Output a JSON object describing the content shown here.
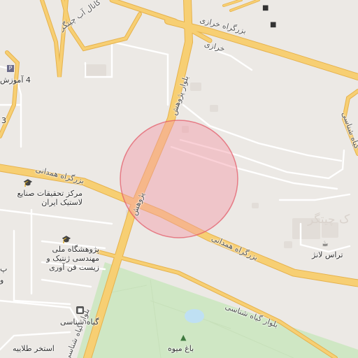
{
  "map": {
    "colors": {
      "land": "#ece9e5",
      "park": "#cfe7c4",
      "park_dark": "#b9dcab",
      "water": "#bfe0f3",
      "motorway": "#f7cf73",
      "motorway_edge": "#e6b24d",
      "street": "#ffffff",
      "circle_fill": "#f39aa6",
      "circle_stroke": "#e25564"
    },
    "marker": {
      "shape": "circle",
      "color": "#e25564"
    },
    "labels": {
      "road_karaj_east": "بزرگراه خرازی",
      "road_karaj_short": "خرازی",
      "road_chitgar_canal": "کانال آب چیتگر",
      "road_pajuhesh_n": "بلوار پژوهش",
      "road_pajuhesh_s": "پژوهش",
      "road_hamedani_w": "بزرگراه همدانی",
      "road_hamedani_e": "بزرگراه همدانی",
      "road_giyah_shenasi_e": "بلوار گیاه شناسی",
      "road_giyah_shenasi_s": "بلوار گیاه شناسی",
      "road_giyah_shenasi_ne": "گیاه شناسی",
      "poi_amozesh": "4 آموزش",
      "poi_num3": "3",
      "poi_research": "مرکز تحقیقات صنایع\nلاستیک ایران",
      "poi_institute": "پژوهشگاه ملی\nمهندسی ژنتیک و\nزیست فن آوری",
      "poi_giyah_station": "گیاه شناسی",
      "poi_pool": "استخر طلاییه",
      "poi_fruit_garden": "باغ میوه",
      "poi_terrace": "تراس لانژ",
      "area_chitgar": "ک چیتگر",
      "poi_side_p": "پ",
      "poi_side_o": "و"
    },
    "icons": {
      "graduation_cap": "graduation-cap-icon",
      "hotel": "hotel-icon",
      "bus": "bus-icon",
      "tree": "tree-icon",
      "cafe": "cafe-icon",
      "parking": "parking-icon"
    }
  }
}
